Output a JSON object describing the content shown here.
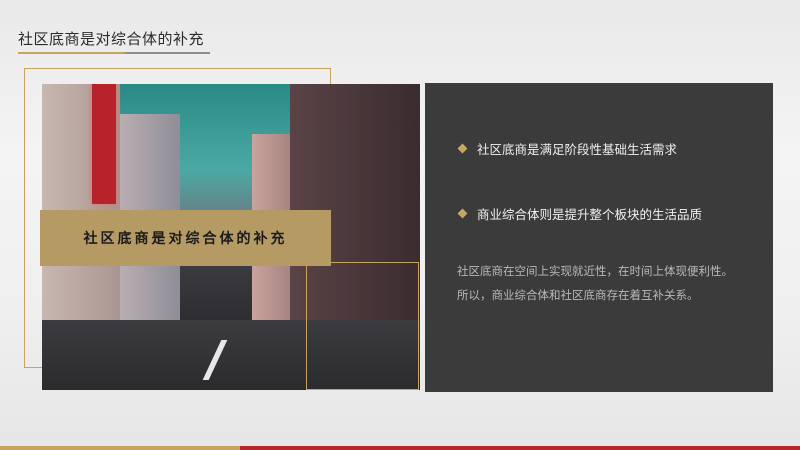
{
  "slide": {
    "title": "社区底商是对综合体的补充",
    "caption": "社区底商是对综合体的补充"
  },
  "panel": {
    "bullets": [
      "社区底商是满足阶段性基础生活需求",
      "商业综合体则是提升整个板块的生活品质"
    ],
    "paragraphs": [
      "社区底商在空间上实现就近性，在时间上体现便利性。",
      "所以，商业综合体和社区底商存在着互补关系。"
    ]
  },
  "colors": {
    "gold": "#c6a35f",
    "panel": "#3b3b3c",
    "accent_red": "#b3262c"
  }
}
